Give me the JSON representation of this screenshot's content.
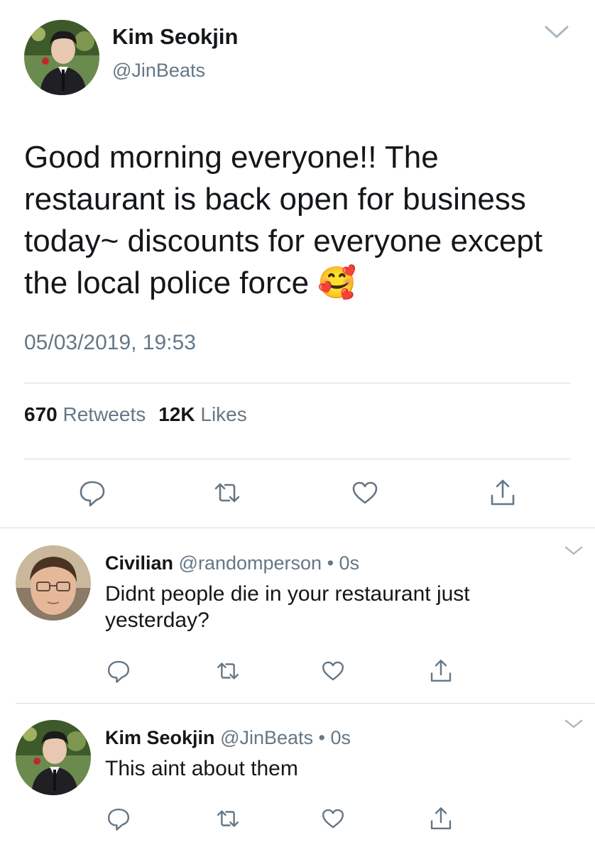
{
  "main_tweet": {
    "name": "Kim Seokjin",
    "handle": "@JinBeats",
    "text": "Good morning everyone!! The restaurant is back open for business today~ discounts for everyone except the local police force",
    "emoji": "🥰",
    "timestamp": "05/03/2019, 19:53",
    "retweet_count": "670",
    "retweet_label": "Retweets",
    "like_count": "12K",
    "like_label": "Likes"
  },
  "replies": [
    {
      "name": "Civilian",
      "handle": "@randomperson",
      "separator": "•",
      "time": "0s",
      "text": "Didnt people die in your restaurant just yesterday?"
    },
    {
      "name": "Kim Seokjin",
      "handle": "@JinBeats",
      "separator": "•",
      "time": "0s",
      "text": "This aint about them"
    }
  ],
  "colors": {
    "text_primary": "#14171a",
    "text_secondary": "#657786",
    "divider": "#d6dbdf",
    "icon": "#657786"
  },
  "icons": [
    "chevron-down-icon",
    "reply-icon",
    "retweet-icon",
    "like-icon",
    "share-icon"
  ]
}
